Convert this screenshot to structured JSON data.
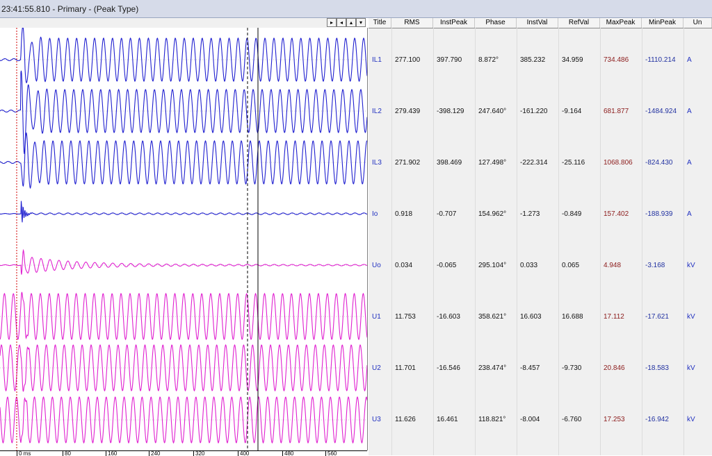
{
  "window": {
    "title": "23:41:55.810 - Primary - (Peak Type)"
  },
  "nav": {
    "right": "▸",
    "first": "◂",
    "up": "▴",
    "down": "▾"
  },
  "table": {
    "columns": [
      "Title",
      "RMS",
      "InstPeak",
      "Phase",
      "InstVal",
      "RefVal",
      "MaxPeak",
      "MinPeak",
      "Un"
    ],
    "rows": [
      {
        "title": "IL1",
        "rms": "277.100",
        "instpeak": "397.790",
        "phase": "8.872°",
        "instval": "385.232",
        "refval": "34.959",
        "maxpeak": "734.486",
        "minpeak": "-1110.214",
        "unit": "A"
      },
      {
        "title": "IL2",
        "rms": "279.439",
        "instpeak": "-398.129",
        "phase": "247.640°",
        "instval": "-161.220",
        "refval": "-9.164",
        "maxpeak": "681.877",
        "minpeak": "-1484.924",
        "unit": "A"
      },
      {
        "title": "IL3",
        "rms": "271.902",
        "instpeak": "398.469",
        "phase": "127.498°",
        "instval": "-222.314",
        "refval": "-25.116",
        "maxpeak": "1068.806",
        "minpeak": "-824.430",
        "unit": "A"
      },
      {
        "title": "Io",
        "rms": "0.918",
        "instpeak": "-0.707",
        "phase": "154.962°",
        "instval": "-1.273",
        "refval": "-0.849",
        "maxpeak": "157.402",
        "minpeak": "-188.939",
        "unit": "A"
      },
      {
        "title": "Uo",
        "rms": "0.034",
        "instpeak": "-0.065",
        "phase": "295.104°",
        "instval": "0.033",
        "refval": "0.065",
        "maxpeak": "4.948",
        "minpeak": "-3.168",
        "unit": "kV"
      },
      {
        "title": "U1",
        "rms": "11.753",
        "instpeak": "-16.603",
        "phase": "358.621°",
        "instval": "16.603",
        "refval": "16.688",
        "maxpeak": "17.112",
        "minpeak": "-17.621",
        "unit": "kV"
      },
      {
        "title": "U2",
        "rms": "11.701",
        "instpeak": "-16.546",
        "phase": "238.474°",
        "instval": "-8.457",
        "refval": "-9.730",
        "maxpeak": "20.846",
        "minpeak": "-18.583",
        "unit": "kV"
      },
      {
        "title": "U3",
        "rms": "11.626",
        "instpeak": "16.461",
        "phase": "118.821°",
        "instval": "-8.004",
        "refval": "-6.760",
        "maxpeak": "17.253",
        "minpeak": "-16.942",
        "unit": "kV"
      }
    ]
  },
  "time_axis": {
    "labels": [
      "0 ms",
      "80",
      "160",
      "240",
      "320",
      "400",
      "480",
      "560"
    ]
  },
  "colors": {
    "current": "#1f1fd0",
    "voltage": "#e020d0",
    "title_text": "#2030c0",
    "maxpeak_text": "#8b1a1a",
    "minpeak_text": "#2030a0"
  }
}
